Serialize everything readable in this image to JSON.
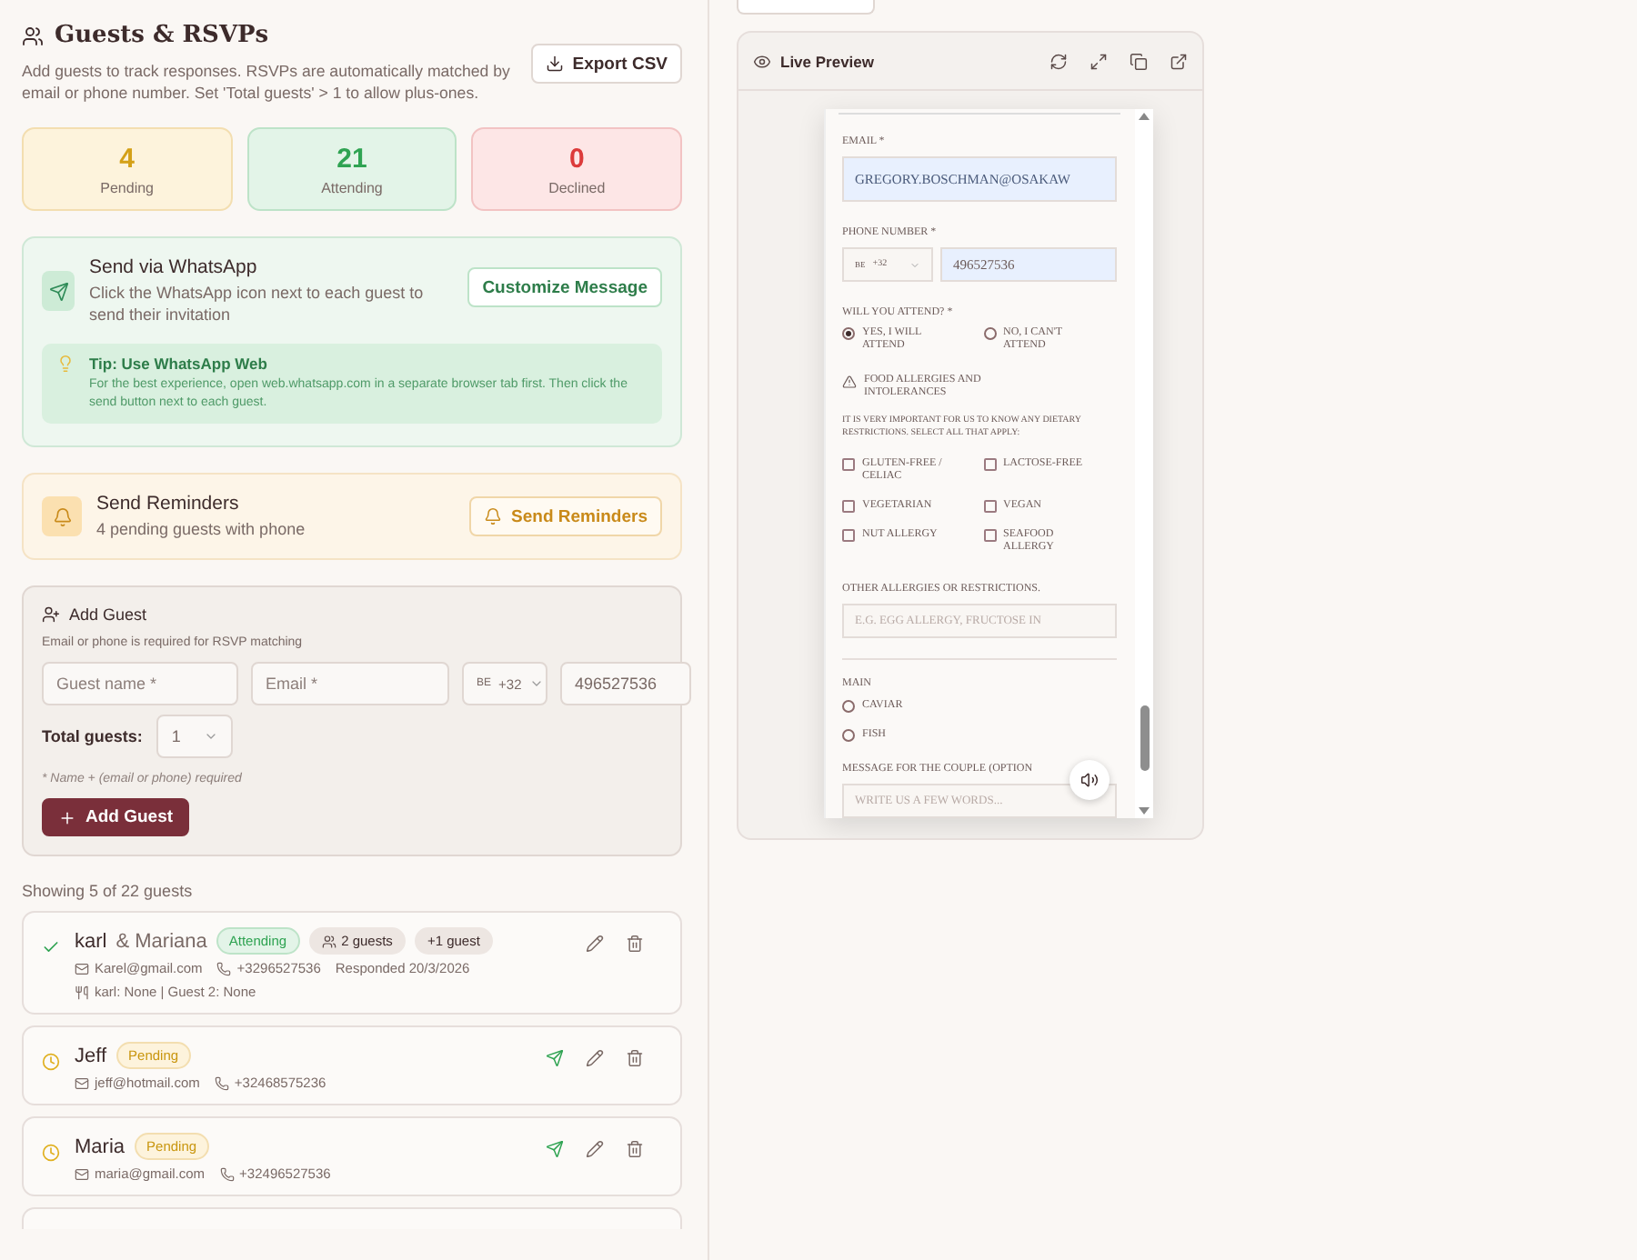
{
  "header": {
    "title": "Guests & RSVPs",
    "description": "Add guests to track responses. RSVPs are automatically matched by email or phone number. Set 'Total guests' > 1 to allow plus-ones.",
    "export_button": "Export CSV"
  },
  "stats": [
    {
      "value": "4",
      "label": "Pending",
      "kind": "pending"
    },
    {
      "value": "21",
      "label": "Attending",
      "kind": "attending"
    },
    {
      "value": "0",
      "label": "Declined",
      "kind": "declined"
    }
  ],
  "whatsapp": {
    "title": "Send via WhatsApp",
    "description": "Click the WhatsApp icon next to each guest to send their invitation",
    "button": "Customize Message",
    "tip_title": "Tip: Use WhatsApp Web",
    "tip_text": "For the best experience, open web.whatsapp.com in a separate browser tab first. Then click the send button next to each guest."
  },
  "reminders": {
    "title": "Send Reminders",
    "subtitle": "4 pending guests with phone",
    "button": "Send Reminders"
  },
  "add_guest": {
    "title": "Add Guest",
    "hint": "Email or phone is required for RSVP matching",
    "name_placeholder": "Guest name *",
    "email_placeholder": "Email *",
    "country_flag": "BE",
    "country_code": "+32",
    "phone_value": "496527536",
    "total_label": "Total guests:",
    "total_value": "1",
    "note": "* Name + (email or phone) required",
    "button": "Add Guest"
  },
  "guest_list": {
    "count": "Showing 5 of 22 guests",
    "guests": [
      {
        "name": "karl",
        "partner": "& Mariana",
        "kind": "attending",
        "status_label": "Attending",
        "party": "2 guests",
        "plus": "+1 guest",
        "email": "Karel@gmail.com",
        "phone": "+3296527536",
        "responded": "Responded 20/3/2026",
        "meals": "karl: None | Guest 2: None",
        "can_send": false
      },
      {
        "name": "Jeff",
        "kind": "pending",
        "status_label": "Pending",
        "email": "jeff@hotmail.com",
        "phone": "+32468575236",
        "can_send": true
      },
      {
        "name": "Maria",
        "kind": "pending",
        "status_label": "Pending",
        "email": "maria@gmail.com",
        "phone": "+32496527536",
        "can_send": true
      }
    ]
  },
  "preview": {
    "title": "Live Preview",
    "email_label": "EMAIL *",
    "email_value": "GREGORY.BOSCHMAN@OSAKAW",
    "phone_label": "PHONE NUMBER *",
    "country_flag": "BE",
    "country_code": "+32",
    "phone_value": "496527536",
    "attend_label": "WILL YOU ATTEND? *",
    "attend_options": [
      {
        "label": "YES, I WILL ATTEND",
        "selected": true
      },
      {
        "label": "NO, I CAN'T ATTEND",
        "selected": false
      }
    ],
    "allergy_title": "FOOD ALLERGIES AND INTOLERANCES",
    "allergy_text": "IT IS VERY IMPORTANT FOR US TO KNOW ANY DIETARY RESTRICTIONS. SELECT ALL THAT APPLY:",
    "allergies": [
      {
        "label": "GLUTEN-FREE / CELIAC",
        "checked": false
      },
      {
        "label": "LACTOSE-FREE",
        "checked": false
      },
      {
        "label": "VEGETARIAN",
        "checked": false
      },
      {
        "label": "VEGAN",
        "checked": false
      },
      {
        "label": "NUT ALLERGY",
        "checked": false
      },
      {
        "label": "SEAFOOD ALLERGY",
        "checked": false
      }
    ],
    "other_label": "OTHER ALLERGIES OR RESTRICTIONS.",
    "other_placeholder": "E.G. EGG ALLERGY, FRUCTOSE IN",
    "main_label": "MAIN",
    "mains": [
      {
        "label": "CAVIAR",
        "selected": false
      },
      {
        "label": "FISH",
        "selected": false
      }
    ],
    "message_label": "MESSAGE FOR THE COUPLE (OPTION",
    "message_placeholder": "WRITE US A FEW WORDS..."
  }
}
